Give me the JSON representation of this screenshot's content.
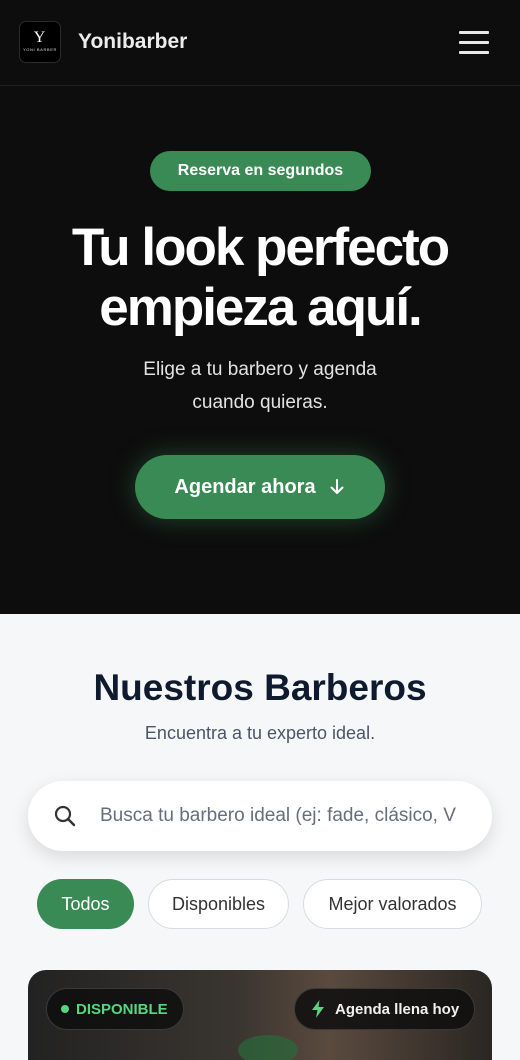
{
  "header": {
    "brand": "Yonibarber",
    "logo_letter": "Y",
    "logo_text": "YONI BARBER"
  },
  "hero": {
    "pill": "Reserva en segundos",
    "title_line1": "Tu look perfecto",
    "title_line2": "empieza aquí.",
    "subtitle_line1": "Elige a tu barbero y agenda",
    "subtitle_line2": "cuando quieras.",
    "cta": "Agendar ahora"
  },
  "section": {
    "title": "Nuestros Barberos",
    "subtitle": "Encuentra a tu experto ideal.",
    "search_placeholder": "Busca tu barbero ideal (ej: fade, clásico, V",
    "filters": [
      "Todos",
      "Disponibles",
      "Mejor valorados"
    ]
  },
  "card": {
    "status": "DISPONIBLE",
    "tag": "Agenda llena hoy"
  },
  "colors": {
    "accent": "#3a8a55",
    "dark": "#0d0d0d",
    "available": "#56d67e"
  }
}
